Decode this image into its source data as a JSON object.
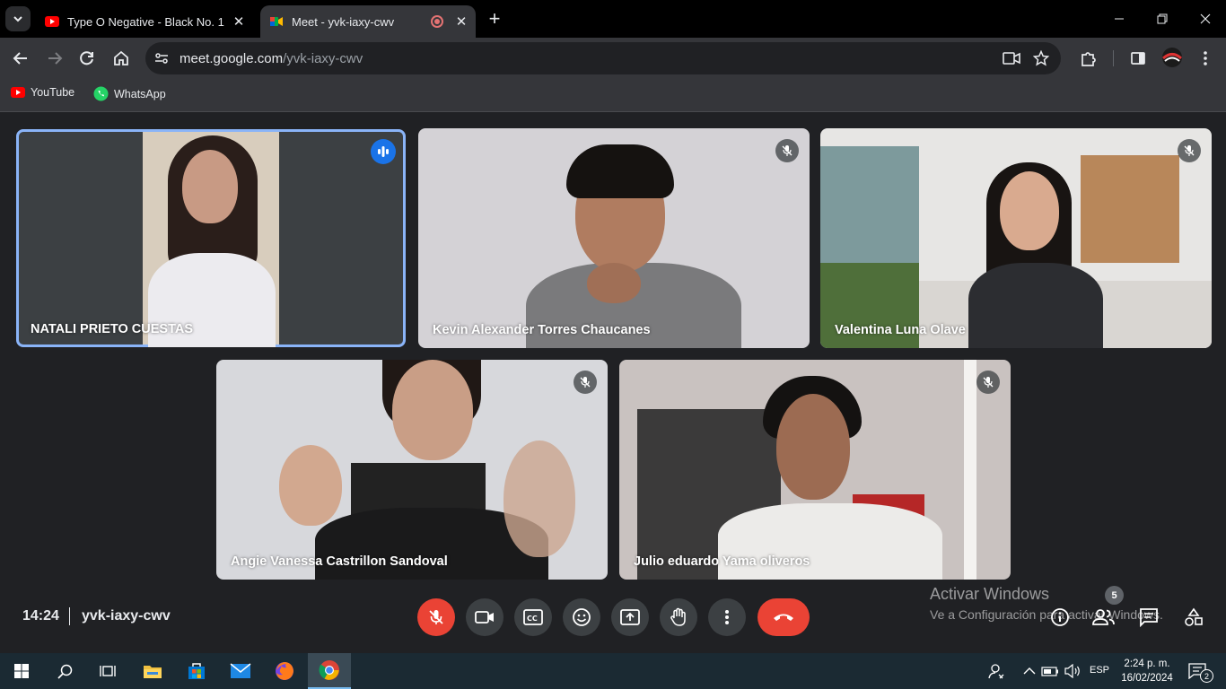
{
  "browser": {
    "tabs": [
      {
        "title": "Type O Negative - Black No. 1 /",
        "favicon": "youtube-icon",
        "active": false
      },
      {
        "title": "Meet - yvk-iaxy-cwv",
        "favicon": "meet-icon",
        "active": true
      }
    ],
    "url_domain": "meet.google.com",
    "url_path": "/yvk-iaxy-cwv",
    "bookmarks": [
      {
        "label": "YouTube",
        "icon": "youtube-icon"
      },
      {
        "label": "WhatsApp",
        "icon": "whatsapp-icon"
      }
    ]
  },
  "meet": {
    "participants": [
      {
        "name": "NATALI PRIETO CUESTAS",
        "speaking": true,
        "muted": false
      },
      {
        "name": "Kevin Alexander Torres Chaucanes",
        "speaking": false,
        "muted": true
      },
      {
        "name": "Valentina Luna Olave",
        "speaking": false,
        "muted": true
      },
      {
        "name": "Angie Vanessa Castrillon Sandoval",
        "speaking": false,
        "muted": true
      },
      {
        "name": "Julio eduardo Yama oliveros",
        "speaking": false,
        "muted": true
      }
    ],
    "time": "14:24",
    "meeting_code": "yvk-iaxy-cwv",
    "people_count": "5",
    "controls": [
      "mic-off-icon",
      "camera-icon",
      "captions-icon",
      "emoji-icon",
      "present-icon",
      "raise-hand-icon",
      "more-icon",
      "end-call-icon"
    ],
    "side_controls": [
      "info-icon",
      "people-icon",
      "chat-icon",
      "activities-icon"
    ]
  },
  "watermark": {
    "line1": "Activar Windows",
    "line2": "Ve a Configuración para activar Windows."
  },
  "taskbar": {
    "language": "ESP",
    "clock_time": "2:24 p. m.",
    "clock_date": "16/02/2024",
    "notification_count": "2"
  },
  "colors": {
    "meet_background": "#202124",
    "end_call_red": "#ea4335",
    "speaker_highlight": "#8ab4f8",
    "speaking_badge": "#1a73e8"
  }
}
